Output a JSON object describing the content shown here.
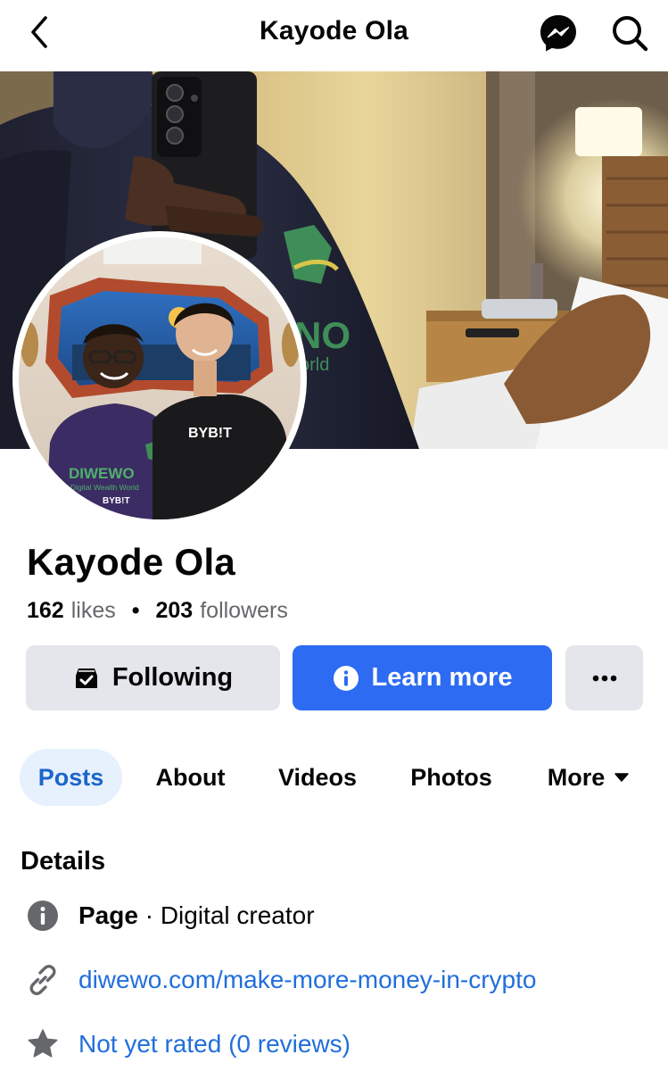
{
  "header": {
    "title": "Kayode Ola"
  },
  "profile": {
    "name": "Kayode Ola",
    "likes_count": "162",
    "likes_label": "likes",
    "separator": "•",
    "followers_count": "203",
    "followers_label": "followers"
  },
  "avatar_shirt": {
    "right_shirt_text": "BYB!T",
    "left_shirt_brand": "DIWEWO",
    "left_shirt_tagline": "Digital Wealth World",
    "left_shirt_sub": "BYB!T"
  },
  "actions": {
    "following_label": "Following",
    "learn_more_label": "Learn more",
    "more_label": "•••"
  },
  "tabs": [
    {
      "label": "Posts"
    },
    {
      "label": "About"
    },
    {
      "label": "Videos"
    },
    {
      "label": "Photos"
    },
    {
      "label": "More"
    }
  ],
  "details": {
    "title": "Details",
    "category_strong": "Page",
    "category_rest": " · Digital creator",
    "website": "diwewo.com/make-more-money-in-crypto",
    "rating": "Not yet rated (0 reviews)"
  },
  "colors": {
    "accent": "#2d6cf2",
    "link": "#216fdb",
    "tab_active_bg": "#e7f0fd",
    "tab_active_text": "#1b66c9",
    "secondary_button_bg": "#e4e6eb",
    "muted_text": "#65676b"
  },
  "icons": {
    "back": "chevron-left-icon",
    "messenger": "messenger-icon",
    "search": "search-icon",
    "following": "following-inbox-icon",
    "learn_more": "info-icon",
    "more_actions": "more-dots-icon",
    "more_tab": "caret-down-icon",
    "info": "info-icon",
    "website": "link-icon",
    "rating": "star-icon"
  }
}
